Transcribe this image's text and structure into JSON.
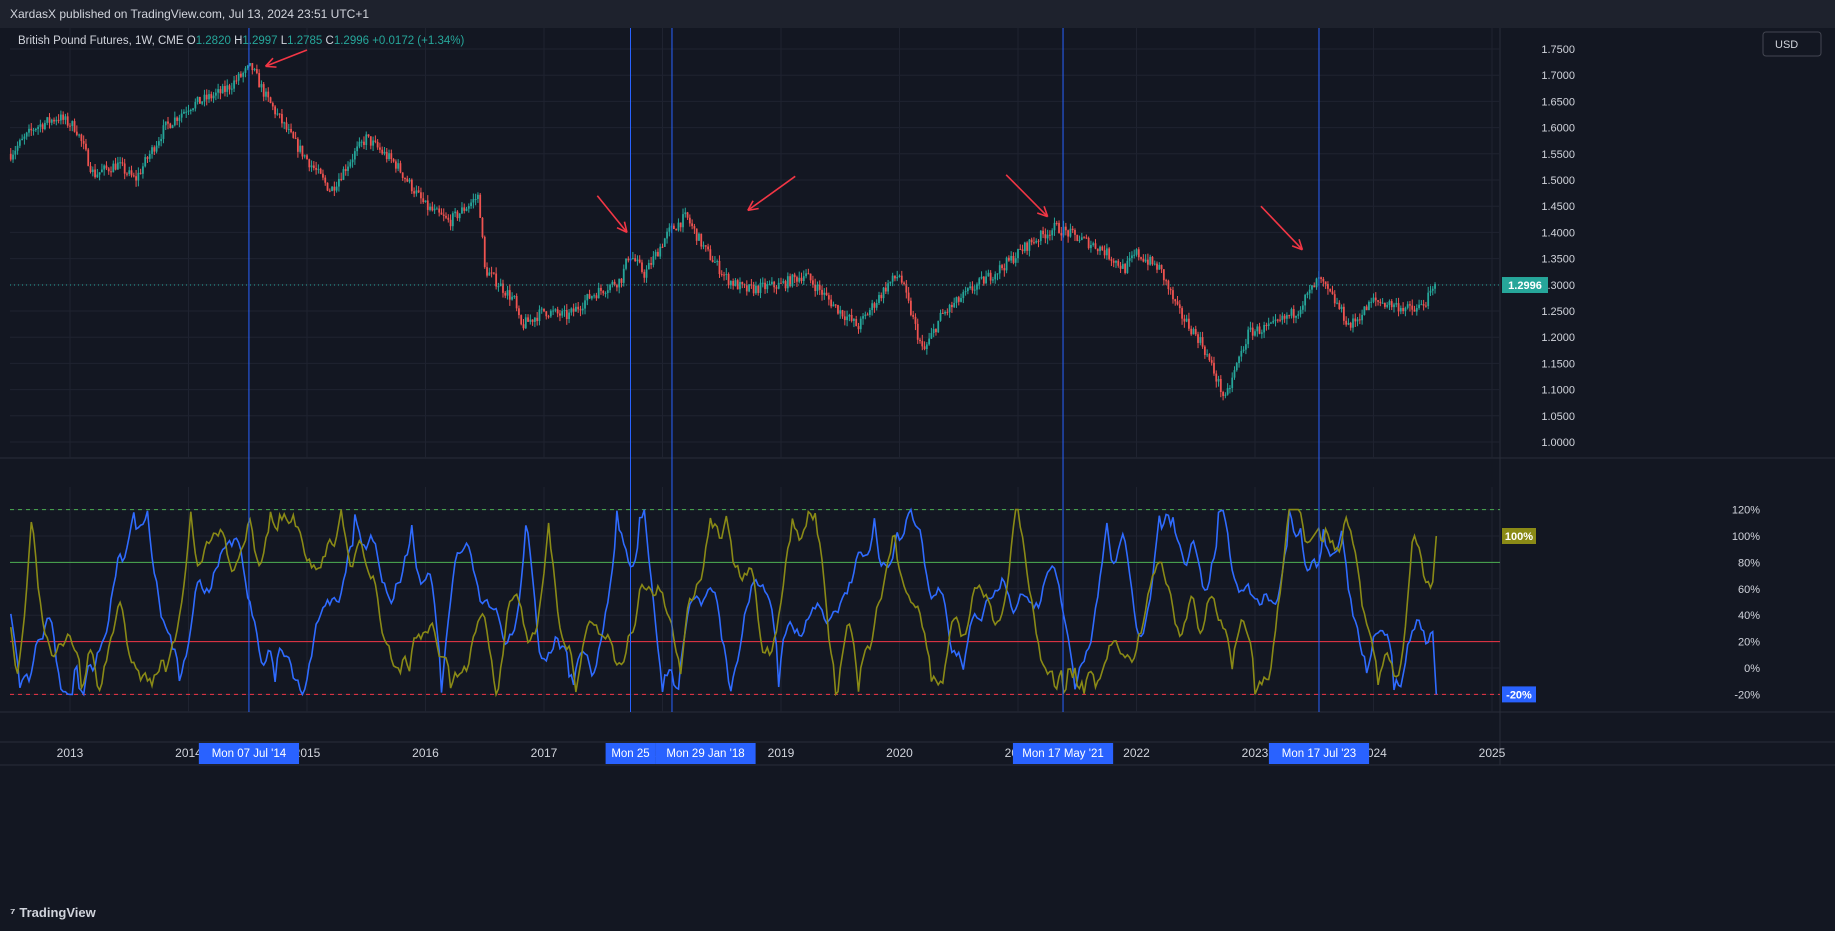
{
  "header": {
    "publish_text": "XardasX published on TradingView.com, Jul 13, 2024 23:51 UTC+1",
    "currency_button": "USD"
  },
  "legend": {
    "symbol": "British Pound Futures, 1W, CME",
    "open_label": "O",
    "open": "1.2820",
    "high_label": "H",
    "high": "1.2997",
    "low_label": "L",
    "low": "1.2785",
    "close_label": "C",
    "close": "1.2996",
    "change": "+0.0172 (+1.34%)"
  },
  "footer": {
    "brand": "TradingView"
  },
  "colors": {
    "background": "#131722",
    "grid": "#1f2330",
    "up": "#26a69a",
    "down": "#ef5350",
    "vline": "#2962ff",
    "arrow": "#f23645",
    "blue_osc": "#2f6bff",
    "olive_osc": "#8a8a16",
    "level_80": "#4caf50",
    "level_20": "#f23645",
    "level_dashed": "#4caf50"
  },
  "chart_data": [
    {
      "type": "candlestick",
      "title": "British Pound Futures, 1W, CME",
      "x_axis_ticks": [
        "2013",
        "2014",
        "2015",
        "2016",
        "2017",
        "2018",
        "2019",
        "2020",
        "2021",
        "2022",
        "2023",
        "2024",
        "2025"
      ],
      "y_axis_ticks": [
        "1.0000",
        "1.0500",
        "1.1000",
        "1.1500",
        "1.2000",
        "1.2500",
        "1.3000",
        "1.3500",
        "1.4000",
        "1.4500",
        "1.5000",
        "1.5500",
        "1.6000",
        "1.6500",
        "1.7000",
        "1.7500"
      ],
      "ylim": [
        0.975,
        1.765
      ],
      "last_price": "1.2996",
      "close_path": [
        {
          "t": 2012.5,
          "v": 1.55
        },
        {
          "t": 2012.7,
          "v": 1.6
        },
        {
          "t": 2012.9,
          "v": 1.62
        },
        {
          "t": 2013.05,
          "v": 1.6
        },
        {
          "t": 2013.2,
          "v": 1.51
        },
        {
          "t": 2013.4,
          "v": 1.53
        },
        {
          "t": 2013.55,
          "v": 1.5
        },
        {
          "t": 2013.8,
          "v": 1.6
        },
        {
          "t": 2014.0,
          "v": 1.64
        },
        {
          "t": 2014.3,
          "v": 1.67
        },
        {
          "t": 2014.53,
          "v": 1.716
        },
        {
          "t": 2014.65,
          "v": 1.66
        },
        {
          "t": 2014.9,
          "v": 1.57
        },
        {
          "t": 2015.2,
          "v": 1.48
        },
        {
          "t": 2015.4,
          "v": 1.55
        },
        {
          "t": 2015.5,
          "v": 1.58
        },
        {
          "t": 2015.75,
          "v": 1.53
        },
        {
          "t": 2016.0,
          "v": 1.45
        },
        {
          "t": 2016.2,
          "v": 1.42
        },
        {
          "t": 2016.45,
          "v": 1.47
        },
        {
          "t": 2016.5,
          "v": 1.33
        },
        {
          "t": 2016.75,
          "v": 1.27
        },
        {
          "t": 2016.8,
          "v": 1.22
        },
        {
          "t": 2017.0,
          "v": 1.25
        },
        {
          "t": 2017.2,
          "v": 1.24
        },
        {
          "t": 2017.4,
          "v": 1.28
        },
        {
          "t": 2017.65,
          "v": 1.31
        },
        {
          "t": 2017.72,
          "v": 1.36
        },
        {
          "t": 2017.85,
          "v": 1.32
        },
        {
          "t": 2018.05,
          "v": 1.4
        },
        {
          "t": 2018.2,
          "v": 1.43
        },
        {
          "t": 2018.35,
          "v": 1.37
        },
        {
          "t": 2018.55,
          "v": 1.31
        },
        {
          "t": 2018.7,
          "v": 1.29
        },
        {
          "t": 2019.0,
          "v": 1.3
        },
        {
          "t": 2019.2,
          "v": 1.32
        },
        {
          "t": 2019.45,
          "v": 1.26
        },
        {
          "t": 2019.65,
          "v": 1.22
        },
        {
          "t": 2019.9,
          "v": 1.3
        },
        {
          "t": 2020.0,
          "v": 1.32
        },
        {
          "t": 2020.2,
          "v": 1.17
        },
        {
          "t": 2020.35,
          "v": 1.24
        },
        {
          "t": 2020.6,
          "v": 1.29
        },
        {
          "t": 2020.9,
          "v": 1.34
        },
        {
          "t": 2021.1,
          "v": 1.38
        },
        {
          "t": 2021.32,
          "v": 1.41
        },
        {
          "t": 2021.5,
          "v": 1.39
        },
        {
          "t": 2021.7,
          "v": 1.37
        },
        {
          "t": 2021.9,
          "v": 1.33
        },
        {
          "t": 2022.0,
          "v": 1.36
        },
        {
          "t": 2022.2,
          "v": 1.33
        },
        {
          "t": 2022.35,
          "v": 1.25
        },
        {
          "t": 2022.55,
          "v": 1.19
        },
        {
          "t": 2022.75,
          "v": 1.08
        },
        {
          "t": 2022.85,
          "v": 1.15
        },
        {
          "t": 2022.95,
          "v": 1.21
        },
        {
          "t": 2023.15,
          "v": 1.22
        },
        {
          "t": 2023.35,
          "v": 1.25
        },
        {
          "t": 2023.54,
          "v": 1.31
        },
        {
          "t": 2023.7,
          "v": 1.26
        },
        {
          "t": 2023.8,
          "v": 1.22
        },
        {
          "t": 2024.0,
          "v": 1.27
        },
        {
          "t": 2024.2,
          "v": 1.26
        },
        {
          "t": 2024.35,
          "v": 1.25
        },
        {
          "t": 2024.45,
          "v": 1.27
        },
        {
          "t": 2024.53,
          "v": 1.2996
        }
      ]
    },
    {
      "type": "line",
      "y_axis_ticks": [
        "120%",
        "100%",
        "80%",
        "60%",
        "40%",
        "20%",
        "0%",
        "-20%"
      ],
      "ylim": [
        -30,
        130
      ],
      "levels": [
        {
          "value": 120,
          "style": "dashed",
          "color": "#4caf50"
        },
        {
          "value": 80,
          "style": "solid",
          "color": "#4caf50"
        },
        {
          "value": 20,
          "style": "solid",
          "color": "#f23645"
        },
        {
          "value": -20,
          "style": "dashed",
          "color": "#f23645"
        }
      ],
      "badges": [
        "100%",
        "-20%"
      ],
      "series": [
        {
          "color": "#2f6bff",
          "last_value": -20
        },
        {
          "color": "#8a8a16",
          "last_value": 100
        }
      ]
    }
  ],
  "markers": [
    {
      "date": 2014.51,
      "label": "Mon 07 Jul '14"
    },
    {
      "date": 2017.73,
      "label": "Mon 25"
    },
    {
      "date": 2018.08,
      "label": "Mon 29 Jan '18"
    },
    {
      "date": 2021.38,
      "label": "Mon 17 May '21"
    },
    {
      "date": 2023.54,
      "label": "Mon 17 Jul '23"
    }
  ],
  "arrows": [
    {
      "from": [
        2015.0,
        1.748
      ],
      "to": [
        2014.65,
        1.717
      ]
    },
    {
      "from": [
        2017.45,
        1.47
      ],
      "to": [
        2017.7,
        1.4
      ]
    },
    {
      "from": [
        2019.12,
        1.507
      ],
      "to": [
        2018.72,
        1.442
      ]
    },
    {
      "from": [
        2020.9,
        1.51
      ],
      "to": [
        2021.25,
        1.43
      ]
    },
    {
      "from": [
        2023.05,
        1.45
      ],
      "to": [
        2023.4,
        1.367
      ]
    }
  ]
}
